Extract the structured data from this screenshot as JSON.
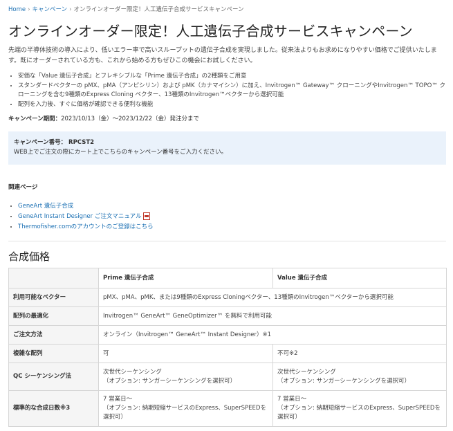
{
  "breadcrumb": {
    "home": "Home",
    "campaign": "キャンペーン",
    "current": "オンラインオーダー限定！人工遺伝子合成サービスキャンペーン"
  },
  "page_title": "オンラインオーダー限定！人工遺伝子合成サービスキャンペーン",
  "intro": "先端の半導体技術の導入により、低いエラー率で高いスループットの遺伝子合成を実現しました。従来法よりもお求めになりやすい価格でご提供いたします。既にオーダーされている方も、これから始める方もぜひこの機会にお試しください。",
  "features": [
    "安価な「Value 遺伝子合成」とフレキシブルな「Prime 遺伝子合成」の2種類をご用意",
    "スタンダードベクターの pMX、pMA（アンピシリン）および pMK（カナマイシン）に加え、Invitrogen™ Gateway™ クローニングやInvitrogen™ TOPO™ クローニングを含む9種類のExpress Cloning ベクター、13種類のInvitrogen™ベクターから選択可能",
    "配列を入力後、すぐに価格が確認できる便利な機能"
  ],
  "period": {
    "label": "キャンペーン期間：",
    "value": "2023/10/13（金）～2023/12/22（金）発注分まで"
  },
  "campaign_box": {
    "code_label": "キャンペーン番号： RPCST2",
    "note": "WEB上でご注文の際にカート上でこちらのキャンペーン番号をご入力ください。"
  },
  "related": {
    "heading": "関連ページ",
    "links": [
      "GeneArt 遺伝子合成",
      "GeneArt Instant Designer ご注文マニュアル",
      "Thermofisher.comのアカウントのご登録はこちら"
    ]
  },
  "section_title": "合成価格",
  "table": {
    "headers": [
      "",
      "Prime 遺伝子合成",
      "Value 遺伝子合成"
    ],
    "rows": [
      {
        "label": "利用可能なベクター",
        "span": true,
        "c1": "pMX、pMA、pMK、または9種類のExpress Cloningベクター、13種類のInvitrogen™ベクターから選択可能"
      },
      {
        "label": "配列の最適化",
        "span": true,
        "c1": "Invitrogen™ GeneArt™ GeneOptimizer™ を無料で利用可能"
      },
      {
        "label": "ご注文方法",
        "span": true,
        "c1": "オンライン（Invitrogen™ GeneArt™ Instant Designer）※1"
      },
      {
        "label": "複雑な配列",
        "span": false,
        "c1": "可",
        "c2": "不可※2"
      },
      {
        "label": "QC シーケンシング法",
        "span": false,
        "c1": "次世代シーケンシング",
        "c1b": "（オプション: サンガーシーケンシングを選択可）",
        "c2": "次世代シーケンシング",
        "c2b": "（オプション: サンガーシーケンシングを選択可）"
      },
      {
        "label": "標準的な合成日数※3",
        "span": false,
        "c1": "7 営業日～",
        "c1b": "（オプション: 納期短縮サービスのExpress、SuperSPEEDを選択可）",
        "c2": "7 営業日～",
        "c2b": "（オプション: 納期短縮サービスのExpress、SuperSPEEDを選択可）"
      }
    ]
  }
}
